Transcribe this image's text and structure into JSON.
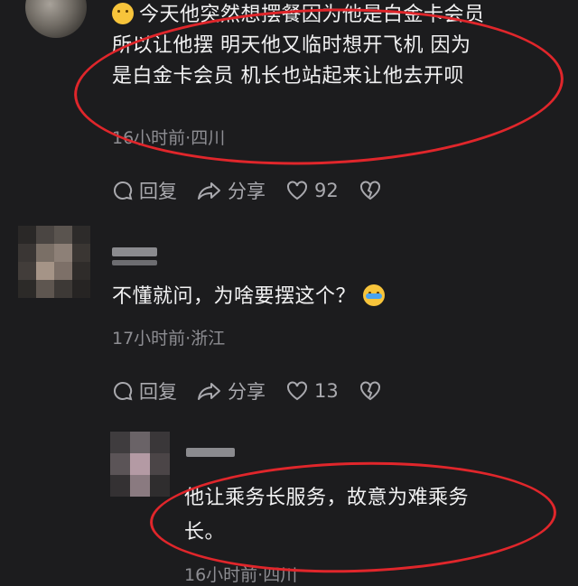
{
  "comments": [
    {
      "text_lines": [
        "今天他突然想摆餐因为他是白金卡会员",
        "所以让他摆  明天他又临时想开飞机  因为",
        "是白金卡会员  机长也站起来让他去开呗"
      ],
      "meta": "16小时前·四川",
      "reply_label": "回复",
      "share_label": "分享",
      "like_count": "92"
    },
    {
      "text": "不懂就问，为啥要摆这个？",
      "meta": "17小时前·浙江",
      "reply_label": "回复",
      "share_label": "分享",
      "like_count": "13"
    },
    {
      "text_lines": [
        "他让乘务长服务，故意为难乘务",
        "长。"
      ],
      "meta": "16小时前·四川"
    }
  ],
  "colors": {
    "background": "#1c1c1e",
    "highlight": "#e0262b"
  }
}
